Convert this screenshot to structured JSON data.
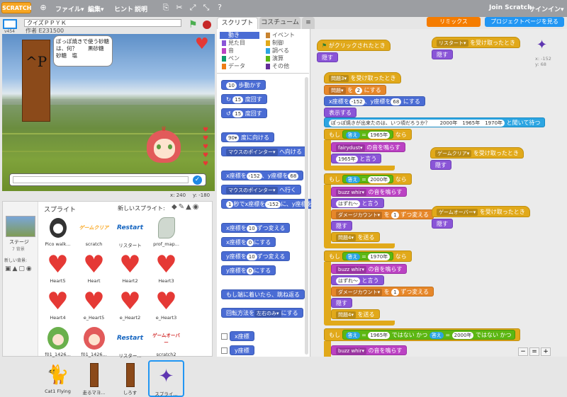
{
  "topbar": {
    "logo": "SCRATCH",
    "file": "ファイル▾",
    "edit": "編集▾",
    "tips": "ヒント",
    "about": "説明",
    "join": "Join Scratch",
    "signin": "サインイン▾"
  },
  "project": {
    "title": "クイズＰＰＹＫ",
    "author": "作者 E231500",
    "version": "v454"
  },
  "stage": {
    "speech": "ぼっぽ焼きで使う砂糖は、何？　　黒砂糖　砂糖　塩",
    "answer_value": "",
    "coords_x": "x: 240",
    "coords_y": "y: -180"
  },
  "tabs": {
    "scripts": "スクリプト",
    "costumes": "コスチューム",
    "sounds": "音"
  },
  "buttons": {
    "remix": "リミックス",
    "seeproject": "プロジェクトページを見る"
  },
  "categories": [
    {
      "label": "動き",
      "color": "#4a6cd4"
    },
    {
      "label": "イベント",
      "color": "#c88330"
    },
    {
      "label": "見た目",
      "color": "#8a55d7"
    },
    {
      "label": "制御",
      "color": "#e1a91a"
    },
    {
      "label": "音",
      "color": "#bb42c3"
    },
    {
      "label": "調べる",
      "color": "#2ca5e2"
    },
    {
      "label": "ペン",
      "color": "#0e9a6c"
    },
    {
      "label": "演算",
      "color": "#5cb712"
    },
    {
      "label": "データ",
      "color": "#ee7d16"
    },
    {
      "label": "その他",
      "color": "#632d99"
    }
  ],
  "palette": {
    "move": "歩動かす",
    "move_n": "10",
    "turn_r": "度回す",
    "turn_r_n": "15",
    "turn_l": "度回す",
    "turn_l_n": "15",
    "point_dir": "度に向ける",
    "point_dir_n": "90▾",
    "point_to": "へ向ける",
    "point_to_v": "マウスのポインター▾",
    "goto_xy_a": "x座標を",
    "goto_xy_x": "-152",
    "goto_xy_b": "、y座標を",
    "goto_xy_y": "68",
    "goto_xy_c": "にする",
    "goto": "へ行く",
    "goto_v": "マウスのポインター▾",
    "glide_a": "秒でx座標を",
    "glide_n": "1",
    "glide_x": "-152",
    "glide_b": "に、y座標を",
    "chx": "x座標を",
    "chx_n": "10",
    "chx_b": "ずつ変える",
    "setx": "x座標を",
    "setx_n": "0",
    "setx_b": "にする",
    "chy": "y座標を",
    "chy_n": "10",
    "chy_b": "ずつ変える",
    "sety": "y座標を",
    "sety_n": "0",
    "sety_b": "にする",
    "bounce": "もし端に着いたら、跳ね返る",
    "rot": "回転方法を",
    "rot_v": "左右のみ▾",
    "rot_b": "にする",
    "chk_x": "x座標",
    "chk_y": "y座標"
  },
  "sprites_header": "スプライト",
  "new_sprite_label": "新しいスプライト:",
  "stage_label": "ステージ",
  "stage_bg": "7 背景",
  "new_bg": "新しい背景:",
  "sprites": [
    {
      "name": "Pico walk...",
      "kind": "pico"
    },
    {
      "name": "scratch",
      "kind": "text-yellow",
      "text": "ゲームクリア"
    },
    {
      "name": "リスタート",
      "kind": "text-blue",
      "text": "Restart"
    },
    {
      "name": "prof_map...",
      "kind": "map"
    },
    {
      "name": "Heart5",
      "kind": "heart"
    },
    {
      "name": "Heart",
      "kind": "heart"
    },
    {
      "name": "Heart2",
      "kind": "heart"
    },
    {
      "name": "Heart3",
      "kind": "heart"
    },
    {
      "name": "Heart4",
      "kind": "heart"
    },
    {
      "name": "e_Heart5",
      "kind": "heart"
    },
    {
      "name": "e_Heart2",
      "kind": "heart"
    },
    {
      "name": "e_Heart3",
      "kind": "heart"
    },
    {
      "name": "f01_1426...",
      "kind": "girl-green"
    },
    {
      "name": "f01_1426...",
      "kind": "girl-red"
    },
    {
      "name": "リスター...",
      "kind": "text-blue",
      "text": "Restart"
    },
    {
      "name": "scratch2",
      "kind": "text-red",
      "text": "ゲームオーバー"
    },
    {
      "name": "Cat1 Flying",
      "kind": "cat"
    },
    {
      "name": "走るマヨ...",
      "kind": "stick"
    },
    {
      "name": "しろす",
      "kind": "stick"
    },
    {
      "name": "スプライ...",
      "kind": "bug"
    }
  ],
  "scripts": {
    "flag_hat": "がクリックされたとき",
    "hide1": "隠す",
    "restart_hat": "を受け取ったとき",
    "restart_v": "リスタート▾",
    "hide2": "隠す",
    "q3_hat": "を受け取ったとき",
    "q3_v": "問題3▾",
    "set_var": "にする",
    "set_var_v": "問題▾",
    "set_var_n": "2",
    "goto_a": "x座標を",
    "goto_x": "-152",
    "goto_b": "、y座標を",
    "goto_y": "68",
    "goto_c": "にする",
    "show": "表示する",
    "ask": "ぽっぽ焼きが出来たのは、いつ頃だろうか？　　2000年　1965年　1970年",
    "ask_tail": "と聞いて待つ",
    "if1_label": "もし",
    "if1_var": "答え",
    "if1_val": "1965年",
    "if1_tail": "なら",
    "play1": "の音を鳴らす",
    "play1_v": "fairydust▾",
    "say1_v": "1965年",
    "say1": "と言う",
    "gc_hat": "を受け取ったとき",
    "gc_v": "ゲームクリア▾",
    "hide3": "隠す",
    "if2_label": "もし",
    "if2_var": "答え",
    "if2_val": "2000年",
    "if2_tail": "なら",
    "play2": "の音を鳴らす",
    "play2_v": "buzz whir▾",
    "say2_v": "はずれ～",
    "say2": "と言う",
    "dmg1_v": "ダメージカウント▾",
    "dmg1_a": "を",
    "dmg1_n": "1",
    "dmg1_b": "ずつ変える",
    "hide4": "隠す",
    "bcast1_v": "問題4▾",
    "bcast1": "を送る",
    "go_hat": "を受け取ったとき",
    "go_v": "ゲームオーバー▾",
    "hide5": "隠す",
    "if3_label": "もし",
    "if3_var": "答え",
    "if3_val": "1970年",
    "if3_tail": "なら",
    "play3": "の音を鳴らす",
    "play3_v": "buzz whir▾",
    "say3_v": "はずれ～",
    "say3": "と言う",
    "dmg2_v": "ダメージカウント▾",
    "dmg2_a": "を",
    "dmg2_n": "1",
    "dmg2_b": "ずつ変える",
    "hide6": "隠す",
    "bcast2_v": "問題4▾",
    "bcast2": "を送る",
    "if4_label": "もし",
    "if4_var": "答え",
    "if4_val": "1965年",
    "if4_not": "ではない",
    "if4_and": "かつ",
    "if4_var2": "答え",
    "if4_val2": "2000年",
    "if4_not2": "ではない",
    "if4_and2": "かつ",
    "play4_v": "buzz whir▾",
    "play4": "の音を鳴らす",
    "sprite_info_x": "x: -152",
    "sprite_info_y": "y: 68"
  },
  "zoom": {
    "out": "−",
    "reset": "=",
    "in": "+"
  }
}
